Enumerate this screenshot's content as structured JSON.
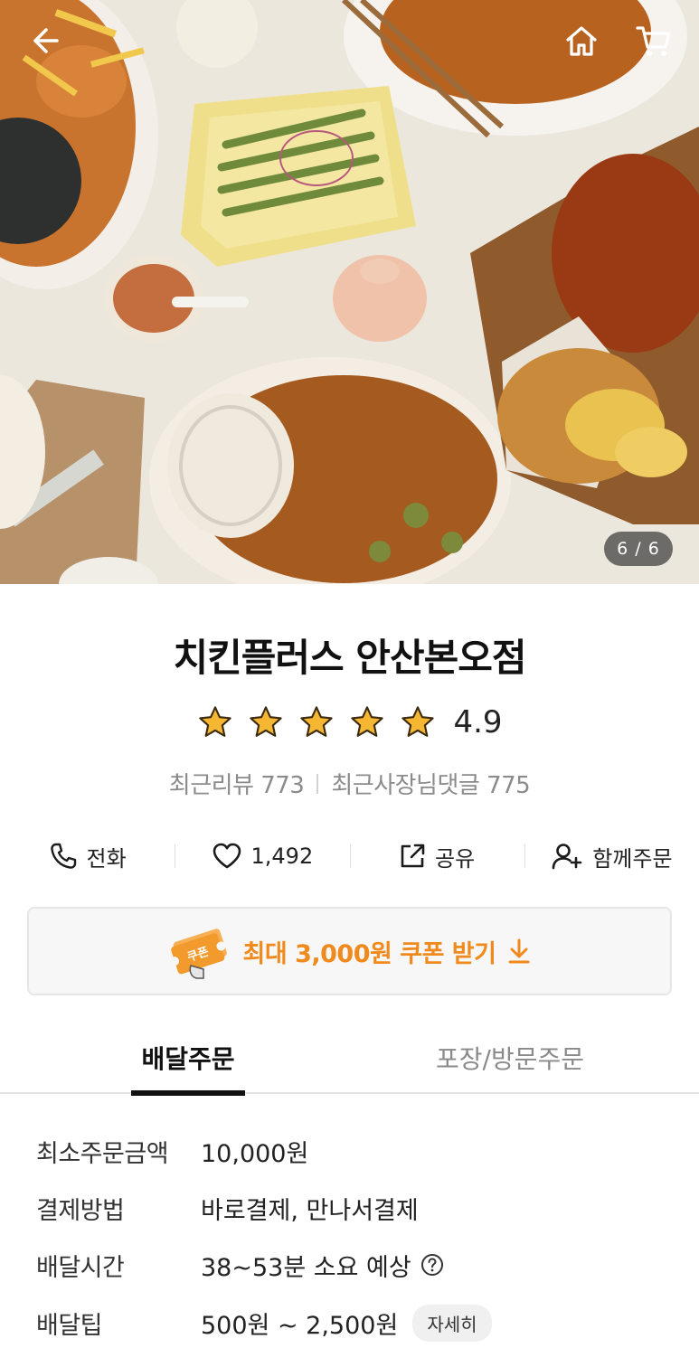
{
  "hero": {
    "image_desc": "food-photo",
    "counter": "6 / 6",
    "icons": {
      "back": "arrow-left-icon",
      "home": "home-icon",
      "cart": "cart-icon"
    }
  },
  "store": {
    "name": "치킨플러스 안산본오점",
    "rating": "4.9",
    "stars": 5,
    "recent_reviews": "최근리뷰 773",
    "owner_replies": "최근사장님댓글 775"
  },
  "actions": [
    {
      "label": "전화",
      "icon": "phone-icon"
    },
    {
      "label": "1,492",
      "icon": "heart-icon"
    },
    {
      "label": "공유",
      "icon": "share-icon"
    },
    {
      "label": "함께주문",
      "icon": "add-person-icon"
    }
  ],
  "coupon": {
    "label": "최대 3,000원 쿠폰 받기",
    "badge": "쿠폰",
    "accent": "#f08a1c"
  },
  "tabs": [
    {
      "label": "배달주문",
      "active": true
    },
    {
      "label": "포장/방문주문",
      "active": false
    }
  ],
  "info": {
    "min_order": {
      "label": "최소주문금액",
      "value": "10,000원"
    },
    "payment": {
      "label": "결제방법",
      "value": "바로결제, 만나서결제"
    },
    "delivery_time": {
      "label": "배달시간",
      "value": "38~53분 소요 예상"
    },
    "delivery_tip": {
      "label": "배달팁",
      "value": "500원 ~ 2,500원",
      "detail_button": "자세히"
    }
  }
}
